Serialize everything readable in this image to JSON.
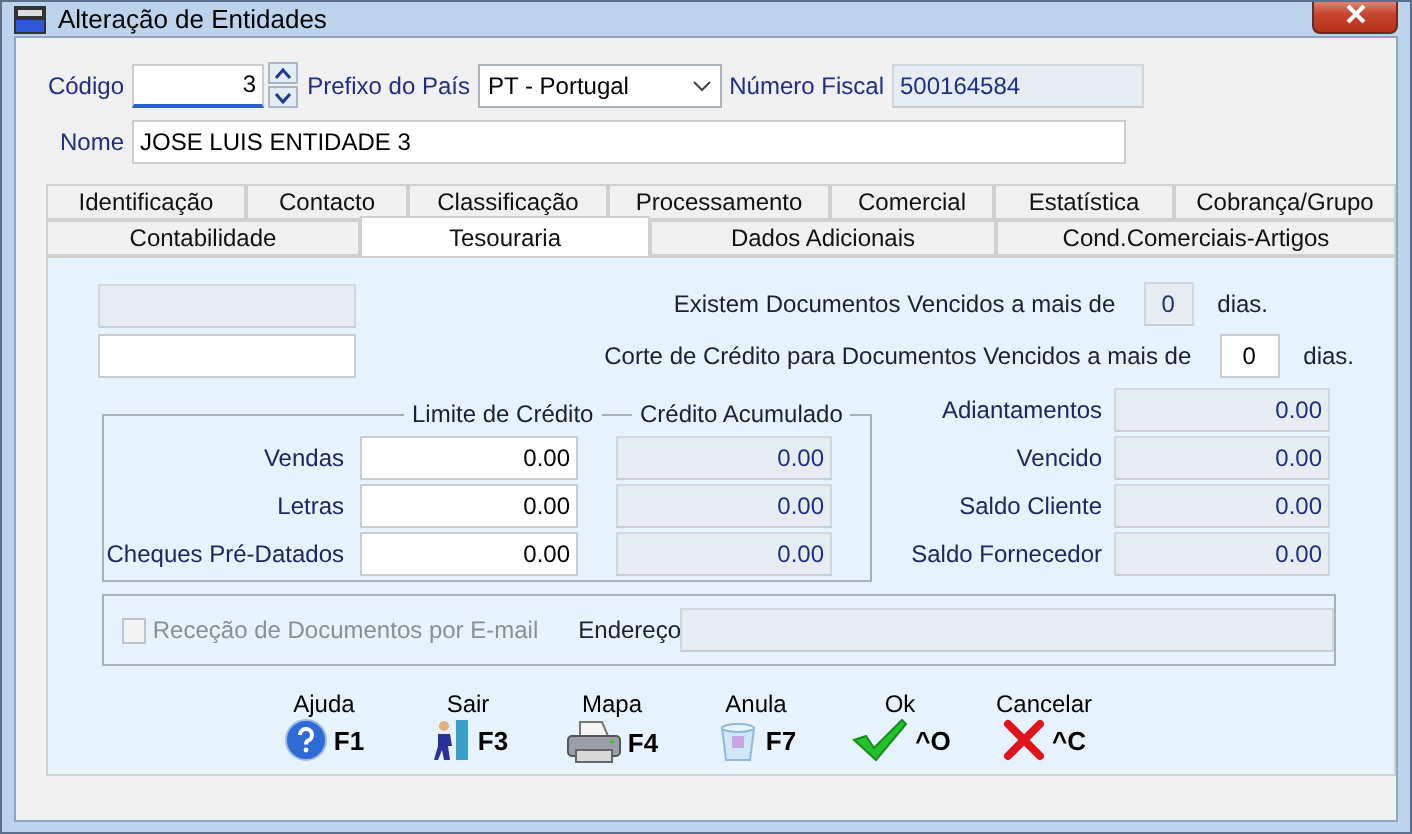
{
  "window": {
    "title": "Alteração de Entidades"
  },
  "header": {
    "codigo": {
      "label": "Código",
      "value": "3",
      "focused": true
    },
    "prefixo": {
      "label": "Prefixo do País",
      "value": "PT - Portugal"
    },
    "numero_fiscal": {
      "label": "Número Fiscal",
      "value": "500164584",
      "readonly": true
    },
    "nome": {
      "label": "Nome",
      "value": "JOSE LUIS ENTIDADE 3",
      "readonly": false
    }
  },
  "tabs": [
    [
      {
        "label": "Identificação",
        "selected": false
      },
      {
        "label": "Contacto",
        "selected": false
      },
      {
        "label": "Classificação",
        "selected": false
      },
      {
        "label": "Processamento",
        "selected": false
      },
      {
        "label": "Comercial",
        "selected": false
      },
      {
        "label": "Estatística",
        "selected": false
      },
      {
        "label": "Cobrança/Grupo",
        "selected": false
      }
    ],
    [
      {
        "label": "Contabilidade",
        "selected": false
      },
      {
        "label": "Tesouraria",
        "selected": true
      },
      {
        "label": "Dados Adicionais",
        "selected": false
      },
      {
        "label": "Cond.Comerciais-Artigos",
        "selected": false
      }
    ]
  ],
  "blank_fields": [
    {
      "readonly": true
    },
    {
      "readonly": false
    }
  ],
  "overdue": [
    {
      "label": "Existem Documentos Vencidos a mais de",
      "value": "0",
      "unit": "dias.",
      "readonly": true
    },
    {
      "label": "Corte de Crédito para Documentos Vencidos a mais de",
      "value": "0",
      "unit": "dias.",
      "readonly": false
    }
  ],
  "credit": {
    "columns": [
      "Limite de Crédito",
      "Crédito Acumulado"
    ],
    "rows": [
      {
        "label": "Vendas",
        "limit": "0.00",
        "accumulated": "0.00"
      },
      {
        "label": "Letras",
        "limit": "0.00",
        "accumulated": "0.00"
      },
      {
        "label": "Cheques Pré-Datados",
        "limit": "0.00",
        "accumulated": "0.00"
      }
    ]
  },
  "balances": [
    {
      "label": "Adiantamentos",
      "value": "0.00"
    },
    {
      "label": "Vencido",
      "value": "0.00"
    },
    {
      "label": "Saldo Cliente",
      "value": "0.00"
    },
    {
      "label": "Saldo Fornecedor",
      "value": "0.00"
    }
  ],
  "email": {
    "label": "Receção de Documentos por E-mail",
    "checked": false,
    "disabled": true,
    "address_label": "Endereço"
  },
  "buttons": [
    {
      "label": "Ajuda",
      "key": "F1",
      "kind": "help"
    },
    {
      "label": "Sair",
      "key": "F3",
      "kind": "exit"
    },
    {
      "label": "Mapa",
      "key": "F4",
      "kind": "print"
    },
    {
      "label": "Anula",
      "key": "F7",
      "kind": "undo"
    },
    {
      "label": "Ok",
      "key": "^O",
      "kind": "confirm"
    },
    {
      "label": "Cancelar",
      "key": "^C",
      "kind": "cancel"
    }
  ]
}
